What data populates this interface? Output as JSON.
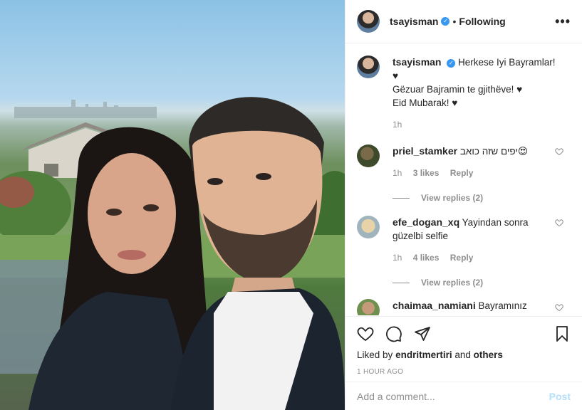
{
  "photo": {
    "alt": "selfie"
  },
  "header": {
    "username": "tsayisman",
    "separator": "•",
    "follow_label": "Following",
    "more_label": "•••"
  },
  "caption": {
    "username": "tsayisman",
    "lines": [
      "Herkese Iyi Bayramlar! ♥",
      "Gëzuar Bajramin te gjithëve! ♥",
      "Eid Mubarak! ♥"
    ],
    "time": "1h"
  },
  "comments": [
    {
      "username": "priel_stamker",
      "text": "יפים שזה כואב😍",
      "time": "1h",
      "likes": "3 likes",
      "reply": "Reply",
      "view_replies": "View replies (2)"
    },
    {
      "username": "efe_dogan_xq",
      "text": "Yayindan sonra güzelbi selfie",
      "time": "1h",
      "likes": "4 likes",
      "reply": "Reply",
      "view_replies": "View replies (2)"
    },
    {
      "username": "chaimaa_namiani",
      "text": "Bayramınız"
    }
  ],
  "likes": {
    "prefix": "Liked by",
    "user": "endritmertiri",
    "middle": "and",
    "others": "others"
  },
  "timestamp": "1 HOUR AGO",
  "comment_box": {
    "placeholder": "Add a comment...",
    "post_label": "Post"
  },
  "colors": {
    "link": "#3897f0",
    "post_disabled": "#b2dffc",
    "muted": "#8e8e8e"
  }
}
